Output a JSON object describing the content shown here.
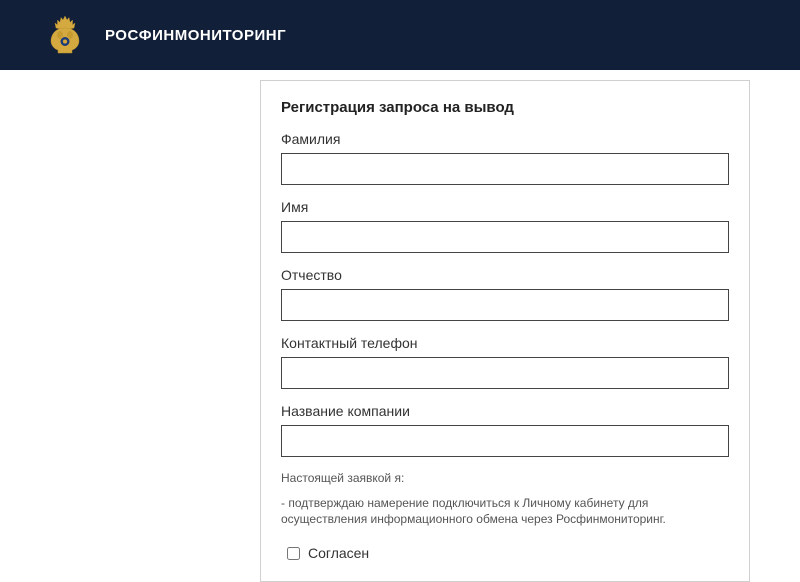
{
  "header": {
    "brand": "РОСФИНМОНИТОРИНГ"
  },
  "form": {
    "title": "Регистрация запроса на вывод",
    "fields": {
      "surname": {
        "label": "Фамилия",
        "value": ""
      },
      "name": {
        "label": "Имя",
        "value": ""
      },
      "patronymic": {
        "label": "Отчество",
        "value": ""
      },
      "phone": {
        "label": "Контактный телефон",
        "value": ""
      },
      "company": {
        "label": "Название компании",
        "value": ""
      }
    },
    "disclosure_lead": "Настоящей заявкой я:",
    "disclosure_text": "- подтверждаю намерение подключиться к Личному кабинету для осуществления информационного обмена через Росфинмониторинг.",
    "consent_label": "Согласен",
    "consent_checked": false
  }
}
